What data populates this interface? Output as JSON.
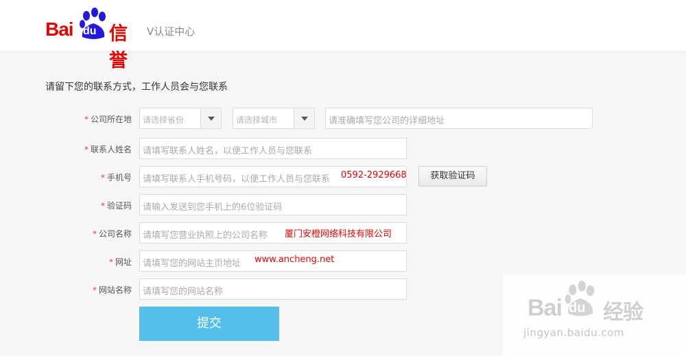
{
  "header": {
    "logo": {
      "bai": "Bai",
      "du": "du",
      "xinyu": "信誉"
    },
    "subtitle": "V认证中心"
  },
  "section_title": "请留下您的联系方式，工作人员会与您联系",
  "form": {
    "required_mark": "*",
    "address": {
      "label": "公司所在地",
      "province_placeholder": "请选择省份",
      "city_placeholder": "请选择城市",
      "detail_placeholder": "请准确填写您公司的详细地址"
    },
    "contact_name": {
      "label": "联系人姓名",
      "placeholder": "请填写联系人姓名，以便工作人员与您联系"
    },
    "phone": {
      "label": "手机号",
      "placeholder": "请填写联系人手机号码，以便工作人员与您联系",
      "value": "0592-2929668",
      "code_button": "获取验证码"
    },
    "verify_code": {
      "label": "验证码",
      "placeholder": "请输入发送到您手机上的6位验证码"
    },
    "company_name": {
      "label": "公司名称",
      "placeholder": "请填写您营业执照上的公司名称",
      "value": "厦门安橙网络科技有限公司"
    },
    "website": {
      "label": "网址",
      "placeholder": "请填写您的网站主页地址",
      "value": "www.ancheng.net"
    },
    "site_name": {
      "label": "网站名称",
      "placeholder": "请填写您的网站名称"
    },
    "submit": "提交"
  },
  "watermark": {
    "bai": "Bai",
    "du": "du",
    "jingyan": "经验",
    "url": "jingyan.baidu.com"
  },
  "colors": {
    "brand_red": "#e10602",
    "submit_blue": "#54bfea",
    "required_red": "#e4393c"
  }
}
